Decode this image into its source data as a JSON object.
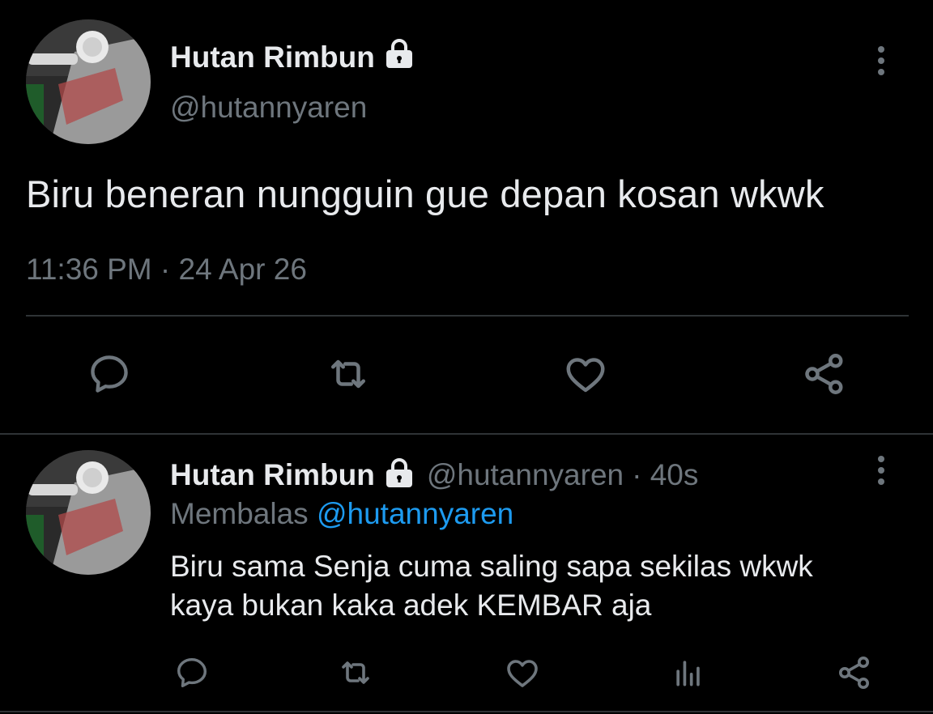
{
  "tweet": {
    "display_name": "Hutan Rimbun",
    "handle": "@hutannyaren",
    "text": "Biru beneran nungguin gue depan kosan wkwk",
    "timestamp": "11:36 PM · 24 Apr 26",
    "actions": [
      "reply-icon",
      "retweet-icon",
      "like-icon",
      "share-icon"
    ]
  },
  "reply": {
    "display_name": "Hutan Rimbun",
    "handle": "@hutannyaren",
    "time": "· 40s",
    "replying_label": "Membalas",
    "replying_to": "@hutannyaren",
    "text_line1": "Biru sama Senja cuma saling sapa sekilas wkwk",
    "text_line2": "kaya bukan kaka adek KEMBAR aja",
    "actions": [
      "reply-icon",
      "retweet-icon",
      "like-icon",
      "analytics-icon",
      "share-icon"
    ]
  },
  "colors": {
    "background": "#000000",
    "primary_text": "#e8eaed",
    "secondary_text": "#6e767d",
    "link": "#1d9bf0",
    "divider": "#2f3336"
  }
}
